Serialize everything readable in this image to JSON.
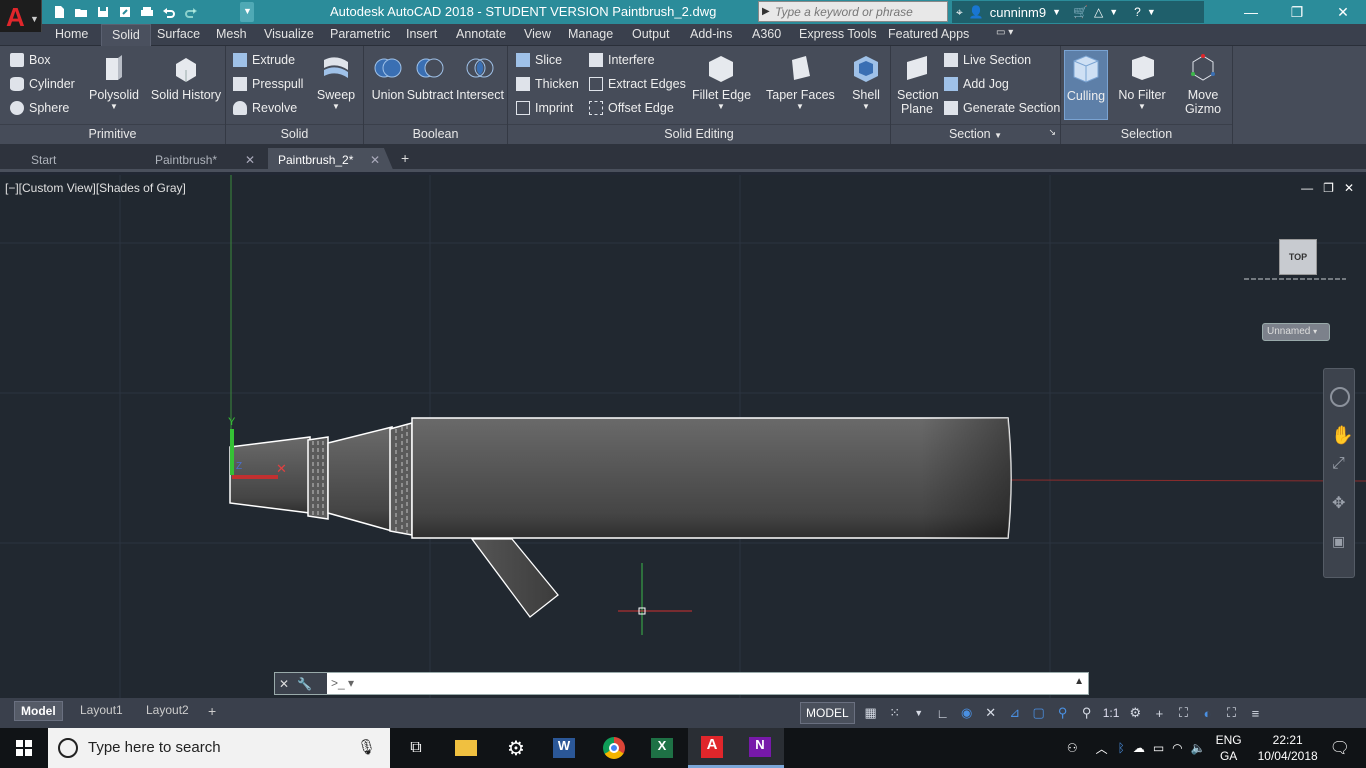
{
  "titlebar": {
    "title": "Autodesk AutoCAD 2018 - STUDENT VERSION    Paintbrush_2.dwg",
    "search_placeholder": "Type a keyword or phrase",
    "user": "cunninm9"
  },
  "ribbon_tabs": [
    "Home",
    "Solid",
    "Surface",
    "Mesh",
    "Visualize",
    "Parametric",
    "Insert",
    "Annotate",
    "View",
    "Manage",
    "Output",
    "Add-ins",
    "A360",
    "Express Tools",
    "Featured Apps"
  ],
  "active_ribbon_tab": "Solid",
  "panels": {
    "primitive": {
      "title": "Primitive",
      "small": [
        "Box",
        "Cylinder",
        "Sphere"
      ],
      "large": [
        "Polysolid",
        "Solid History"
      ]
    },
    "solid": {
      "title": "Solid",
      "small": [
        "Extrude",
        "Presspull",
        "Revolve"
      ],
      "large": [
        "Sweep"
      ]
    },
    "boolean": {
      "title": "Boolean",
      "large": [
        "Union",
        "Subtract",
        "Intersect"
      ]
    },
    "solid_editing": {
      "title": "Solid Editing",
      "small": [
        "Slice",
        "Thicken",
        "Imprint",
        "Interfere",
        "Extract Edges",
        "Offset Edge"
      ],
      "large": [
        "Fillet Edge",
        "Taper Faces",
        "Shell"
      ]
    },
    "section": {
      "title": "Section",
      "large": [
        "Section Plane"
      ],
      "small": [
        "Live Section",
        "Add Jog",
        "Generate Section"
      ]
    },
    "selection": {
      "title": "Selection",
      "large": [
        "Culling",
        "No Filter",
        "Move Gizmo"
      ]
    }
  },
  "doc_tabs": [
    "Start",
    "Paintbrush*",
    "Paintbrush_2*"
  ],
  "active_doc_tab": "Paintbrush_2*",
  "viewport": {
    "label": "[−][Custom View][Shades of Gray]",
    "viewcube_face": "TOP",
    "named_view": "Unnamed"
  },
  "layout_tabs": [
    "Model",
    "Layout1",
    "Layout2"
  ],
  "status": {
    "space": "MODEL",
    "scale": "1:1"
  },
  "taskbar": {
    "search": "Type here to search",
    "lang1": "ENG",
    "lang2": "GA",
    "time": "22:21",
    "date": "10/04/2018"
  },
  "colors": {
    "titlebar": "#2b8c9a",
    "ribbon": "#464c59",
    "viewport": "#212830",
    "accent_red": "#e0262b"
  }
}
